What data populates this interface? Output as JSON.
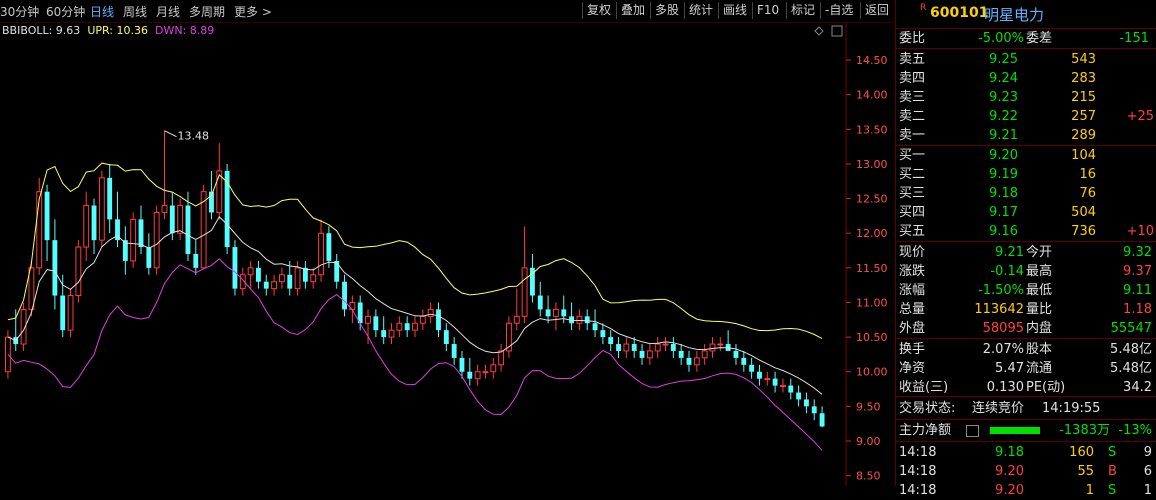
{
  "toolbar": {
    "periods": [
      "30分钟",
      "60分钟",
      "日线",
      "周线",
      "月线",
      "多周期",
      "更多 >"
    ],
    "active_period": "日线",
    "buttons": [
      "复权",
      "叠加",
      "多股",
      "统计",
      "画线",
      "F10",
      "标记",
      "-自选",
      "返回"
    ]
  },
  "indicator": {
    "name": "BBIBOLL",
    "values": [
      {
        "label": "BBIBOLL: 9.63",
        "color": "#e0e0e0"
      },
      {
        "label": "UPR: 10.36",
        "color": "#ffff60"
      },
      {
        "label": "DWN: 8.89",
        "color": "#e040e0"
      }
    ]
  },
  "chart_data": {
    "type": "candlestick",
    "y_ticks": [
      "14.50",
      "14.00",
      "13.50",
      "13.00",
      "12.50",
      "12.00",
      "11.50",
      "11.00",
      "10.50",
      "10.00",
      "9.50",
      "9.00",
      "8.50"
    ],
    "ylim": [
      8.35,
      15.05
    ],
    "annotation": "13.48",
    "candles": [
      [
        10.0,
        10.6,
        9.9,
        10.5
      ],
      [
        10.5,
        10.9,
        10.3,
        10.4
      ],
      [
        10.4,
        11.0,
        10.3,
        10.9
      ],
      [
        10.9,
        11.6,
        10.8,
        11.5
      ],
      [
        11.5,
        12.8,
        11.4,
        12.6
      ],
      [
        12.6,
        12.7,
        11.6,
        11.9
      ],
      [
        11.9,
        12.2,
        10.9,
        11.1
      ],
      [
        11.1,
        11.4,
        10.5,
        10.6
      ],
      [
        10.6,
        11.2,
        10.5,
        11.1
      ],
      [
        11.1,
        11.9,
        11.0,
        11.8
      ],
      [
        11.8,
        12.6,
        11.6,
        12.4
      ],
      [
        12.4,
        12.5,
        11.7,
        11.9
      ],
      [
        11.9,
        12.9,
        11.8,
        12.8
      ],
      [
        12.8,
        13.0,
        12.0,
        12.2
      ],
      [
        12.2,
        12.6,
        11.8,
        11.9
      ],
      [
        11.9,
        12.1,
        11.4,
        11.6
      ],
      [
        11.6,
        12.3,
        11.5,
        12.2
      ],
      [
        12.2,
        12.4,
        11.7,
        11.8
      ],
      [
        11.8,
        12.0,
        11.4,
        11.5
      ],
      [
        11.5,
        12.4,
        11.4,
        12.3
      ],
      [
        12.3,
        13.48,
        12.2,
        12.4
      ],
      [
        12.4,
        12.6,
        11.9,
        12.0
      ],
      [
        12.0,
        12.5,
        11.9,
        12.4
      ],
      [
        12.4,
        12.6,
        11.6,
        11.7
      ],
      [
        11.7,
        11.9,
        11.4,
        11.5
      ],
      [
        11.5,
        12.7,
        11.5,
        12.6
      ],
      [
        12.6,
        12.9,
        12.2,
        12.3
      ],
      [
        12.3,
        13.3,
        12.2,
        12.9
      ],
      [
        12.9,
        13.0,
        11.7,
        11.8
      ],
      [
        11.8,
        11.9,
        11.1,
        11.2
      ],
      [
        11.2,
        11.5,
        11.1,
        11.4
      ],
      [
        11.4,
        11.6,
        11.2,
        11.5
      ],
      [
        11.5,
        11.6,
        11.2,
        11.3
      ],
      [
        11.3,
        11.4,
        11.1,
        11.2
      ],
      [
        11.2,
        11.4,
        11.1,
        11.3
      ],
      [
        11.3,
        11.5,
        11.2,
        11.4
      ],
      [
        11.4,
        11.6,
        11.1,
        11.2
      ],
      [
        11.2,
        11.6,
        11.1,
        11.5
      ],
      [
        11.5,
        11.6,
        11.2,
        11.3
      ],
      [
        11.3,
        11.5,
        11.2,
        11.4
      ],
      [
        11.4,
        12.2,
        11.3,
        12.0
      ],
      [
        12.0,
        12.1,
        11.5,
        11.6
      ],
      [
        11.6,
        11.7,
        11.2,
        11.3
      ],
      [
        11.3,
        11.4,
        10.8,
        10.9
      ],
      [
        10.9,
        11.1,
        10.7,
        11.0
      ],
      [
        11.0,
        11.1,
        10.6,
        10.7
      ],
      [
        10.7,
        10.9,
        10.4,
        10.8
      ],
      [
        10.8,
        10.9,
        10.5,
        10.6
      ],
      [
        10.6,
        10.8,
        10.4,
        10.5
      ],
      [
        10.5,
        10.7,
        10.4,
        10.6
      ],
      [
        10.6,
        10.8,
        10.5,
        10.7
      ],
      [
        10.7,
        10.8,
        10.5,
        10.6
      ],
      [
        10.6,
        10.8,
        10.5,
        10.7
      ],
      [
        10.7,
        10.9,
        10.6,
        10.8
      ],
      [
        10.8,
        11.0,
        10.7,
        10.9
      ],
      [
        10.9,
        11.0,
        10.5,
        10.6
      ],
      [
        10.6,
        10.7,
        10.3,
        10.4
      ],
      [
        10.4,
        10.5,
        10.1,
        10.2
      ],
      [
        10.2,
        10.3,
        9.9,
        10.0
      ],
      [
        10.0,
        10.2,
        9.8,
        9.9
      ],
      [
        9.9,
        10.1,
        9.8,
        10.0
      ],
      [
        10.0,
        10.1,
        9.9,
        10.0
      ],
      [
        10.0,
        10.2,
        9.9,
        10.1
      ],
      [
        10.1,
        10.4,
        10.0,
        10.3
      ],
      [
        10.3,
        10.8,
        10.2,
        10.7
      ],
      [
        10.7,
        11.2,
        10.6,
        10.8
      ],
      [
        10.8,
        12.1,
        10.7,
        11.5
      ],
      [
        11.5,
        11.7,
        11.0,
        11.1
      ],
      [
        11.1,
        11.3,
        10.8,
        10.9
      ],
      [
        10.9,
        11.1,
        10.7,
        10.8
      ],
      [
        10.8,
        11.0,
        10.6,
        10.9
      ],
      [
        10.9,
        11.1,
        10.7,
        10.8
      ],
      [
        10.8,
        11.0,
        10.6,
        10.7
      ],
      [
        10.7,
        10.9,
        10.6,
        10.8
      ],
      [
        10.8,
        10.9,
        10.6,
        10.7
      ],
      [
        10.7,
        10.9,
        10.5,
        10.6
      ],
      [
        10.6,
        10.7,
        10.4,
        10.5
      ],
      [
        10.5,
        10.6,
        10.3,
        10.4
      ],
      [
        10.4,
        10.5,
        10.2,
        10.3
      ],
      [
        10.3,
        10.5,
        10.2,
        10.4
      ],
      [
        10.4,
        10.5,
        10.2,
        10.3
      ],
      [
        10.3,
        10.4,
        10.1,
        10.2
      ],
      [
        10.2,
        10.4,
        10.1,
        10.3
      ],
      [
        10.3,
        10.5,
        10.2,
        10.4
      ],
      [
        10.4,
        10.5,
        10.3,
        10.4
      ],
      [
        10.4,
        10.5,
        10.2,
        10.3
      ],
      [
        10.3,
        10.4,
        10.1,
        10.2
      ],
      [
        10.2,
        10.3,
        10.0,
        10.1
      ],
      [
        10.1,
        10.3,
        10.0,
        10.2
      ],
      [
        10.2,
        10.4,
        10.1,
        10.3
      ],
      [
        10.3,
        10.5,
        10.2,
        10.4
      ],
      [
        10.4,
        10.5,
        10.3,
        10.4
      ],
      [
        10.4,
        10.6,
        10.3,
        10.3
      ],
      [
        10.3,
        10.4,
        10.1,
        10.2
      ],
      [
        10.2,
        10.3,
        10.0,
        10.1
      ],
      [
        10.1,
        10.2,
        9.9,
        10.0
      ],
      [
        10.0,
        10.1,
        9.8,
        9.9
      ],
      [
        9.9,
        10.0,
        9.8,
        9.9
      ],
      [
        9.9,
        10.0,
        9.7,
        9.8
      ],
      [
        9.8,
        9.9,
        9.7,
        9.8
      ],
      [
        9.8,
        9.9,
        9.6,
        9.7
      ],
      [
        9.7,
        9.8,
        9.5,
        9.6
      ],
      [
        9.6,
        9.7,
        9.4,
        9.5
      ],
      [
        9.5,
        9.6,
        9.3,
        9.4
      ],
      [
        9.4,
        9.5,
        9.2,
        9.21
      ]
    ],
    "series": [
      {
        "name": "BBIBOLL",
        "color": "#e0e0e0"
      },
      {
        "name": "UPR",
        "color": "#ffff60"
      },
      {
        "name": "DWN",
        "color": "#e040e0"
      }
    ]
  },
  "quote": {
    "code": "600101",
    "name": "明星电力",
    "flag": "R",
    "wei_bi_label": "委比",
    "wei_bi": "-5.00%",
    "wei_cha_label": "委差",
    "wei_cha": "-151",
    "asks": [
      {
        "label": "卖五",
        "price": "9.25",
        "vol": "543",
        "chg": ""
      },
      {
        "label": "卖四",
        "price": "9.24",
        "vol": "283",
        "chg": ""
      },
      {
        "label": "卖三",
        "price": "9.23",
        "vol": "215",
        "chg": ""
      },
      {
        "label": "卖二",
        "price": "9.22",
        "vol": "257",
        "chg": "+25"
      },
      {
        "label": "卖一",
        "price": "9.21",
        "vol": "289",
        "chg": ""
      }
    ],
    "bids": [
      {
        "label": "买一",
        "price": "9.20",
        "vol": "104",
        "chg": ""
      },
      {
        "label": "买二",
        "price": "9.19",
        "vol": "16",
        "chg": ""
      },
      {
        "label": "买三",
        "price": "9.18",
        "vol": "76",
        "chg": ""
      },
      {
        "label": "买四",
        "price": "9.17",
        "vol": "504",
        "chg": ""
      },
      {
        "label": "买五",
        "price": "9.16",
        "vol": "736",
        "chg": "+10"
      }
    ],
    "stats": [
      {
        "l1": "现价",
        "v1": "9.21",
        "c1": "green",
        "l2": "今开",
        "v2": "9.32",
        "c2": "green"
      },
      {
        "l1": "涨跌",
        "v1": "-0.14",
        "c1": "green",
        "l2": "最高",
        "v2": "9.37",
        "c2": "red"
      },
      {
        "l1": "涨幅",
        "v1": "-1.50%",
        "c1": "green",
        "l2": "最低",
        "v2": "9.11",
        "c2": "green"
      },
      {
        "l1": "总量",
        "v1": "113642",
        "c1": "yel",
        "l2": "量比",
        "v2": "1.18",
        "c2": "red"
      },
      {
        "l1": "外盘",
        "v1": "58095",
        "c1": "red",
        "l2": "内盘",
        "v2": "55547",
        "c2": "green"
      }
    ],
    "fundamentals": [
      {
        "l1": "换手",
        "v1": "2.07%",
        "l2": "股本",
        "v2": "5.48亿"
      },
      {
        "l1": "净资",
        "v1": "5.47",
        "l2": "流通",
        "v2": "5.48亿"
      },
      {
        "l1": "收益(三)",
        "v1": "0.130",
        "l2": "PE(动)",
        "v2": "34.2"
      }
    ],
    "trade_status_label": "交易状态:",
    "trade_status": "连续竞价",
    "trade_time": "14:19:55",
    "main_flow_label": "主力净额",
    "main_flow": "-1383万",
    "main_flow_pct": "-13%",
    "ticks": [
      {
        "time": "14:18",
        "price": "9.18",
        "vol": "160",
        "side": "S",
        "num": "9"
      },
      {
        "time": "14:18",
        "price": "9.20",
        "vol": "55",
        "side": "B",
        "num": "6"
      },
      {
        "time": "14:18",
        "price": "9.20",
        "vol": "1",
        "side": "S",
        "num": "1"
      }
    ]
  }
}
